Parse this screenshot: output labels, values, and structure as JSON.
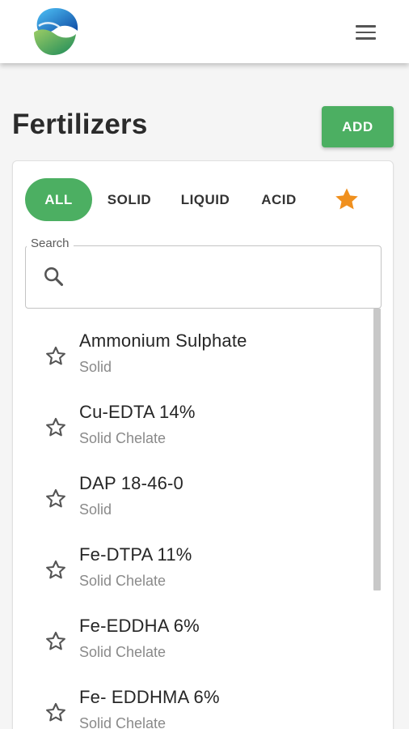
{
  "app": {
    "title": "Fertilizers",
    "add_label": "ADD"
  },
  "colors": {
    "accent": "#4caf62",
    "favorite": "#f0901e",
    "logo_blue": "#1565c0",
    "logo_green": "#43a047"
  },
  "icons": {
    "menu": "hamburger-menu-icon",
    "search": "magnifier-icon",
    "favorite_filled": "star-filled-icon",
    "favorite_outline": "star-outline-icon"
  },
  "tabs": [
    {
      "label": "ALL",
      "active": true
    },
    {
      "label": "SOLID",
      "active": false
    },
    {
      "label": "LIQUID",
      "active": false
    },
    {
      "label": "ACID",
      "active": false
    }
  ],
  "search": {
    "label": "Search",
    "value": ""
  },
  "items": [
    {
      "name": "Ammonium Sulphate",
      "type": "Solid"
    },
    {
      "name": "Cu-EDTA 14%",
      "type": "Solid Chelate"
    },
    {
      "name": "DAP 18-46-0",
      "type": "Solid"
    },
    {
      "name": "Fe-DTPA 11%",
      "type": "Solid Chelate"
    },
    {
      "name": "Fe-EDDHA 6%",
      "type": "Solid Chelate"
    },
    {
      "name": "Fe- EDDHMA 6%",
      "type": "Solid Chelate"
    }
  ]
}
